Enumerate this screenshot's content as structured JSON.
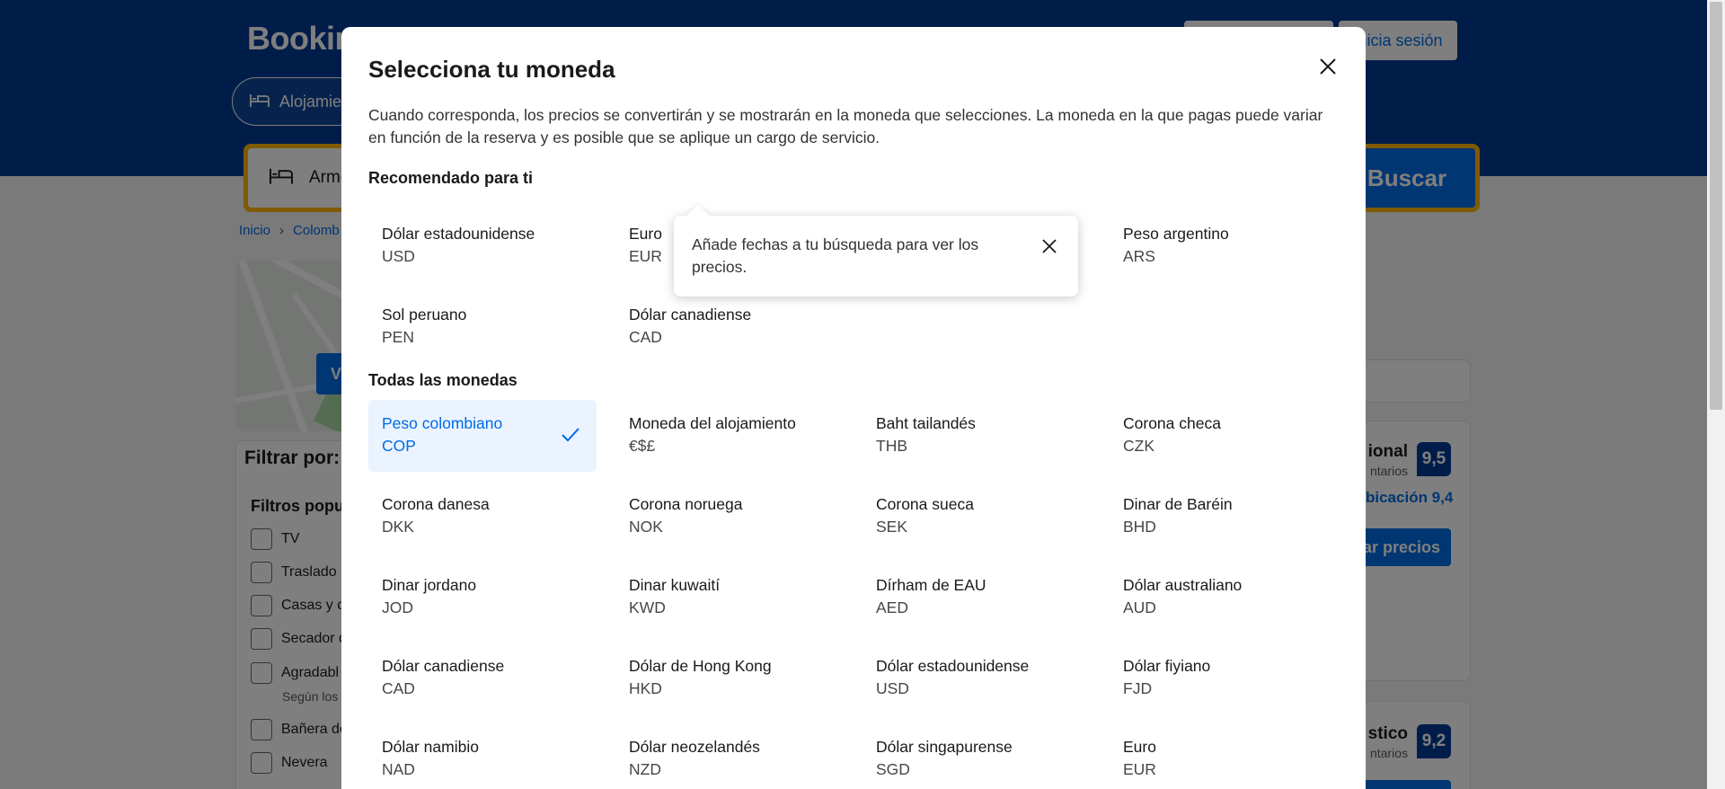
{
  "background": {
    "logo": "Booking",
    "header_buttons": [
      "",
      "Inicia sesión"
    ],
    "nav_pill": "Alojamie",
    "search_field": "Arme",
    "search_button": "Buscar",
    "breadcrumb": [
      "Inicio",
      "Colomb"
    ],
    "map_button": "V",
    "filters_title": "Filtrar por:",
    "filters_subtitle": "Filtros popul",
    "filter_items": [
      "TV",
      "Traslado",
      "Casas y c",
      "Secador d",
      "Agradabl",
      "Bañera de",
      "Nevera"
    ],
    "filter_note": "Según los",
    "cards": [
      {
        "name": "ional",
        "sub": "ntarios",
        "score": "9,5",
        "location": "bicación 9,4",
        "button": "ar precios"
      },
      {
        "name": "stico",
        "sub": "ntarios",
        "score": "9,2"
      }
    ]
  },
  "modal": {
    "title": "Selecciona tu moneda",
    "description": "Cuando corresponda, los precios se convertirán y se mostrarán en la moneda que selecciones. La moneda en la que pagas puede variar en función de la reserva y es posible que se aplique un cargo de servicio.",
    "recommended_heading": "Recomendado para ti",
    "recommended": [
      {
        "name": "Dólar estadounidense",
        "code": "USD"
      },
      {
        "name": "Euro",
        "code": "EUR"
      },
      {
        "name": "Peso argentino",
        "code": "ARS"
      },
      {
        "name": "Sol peruano",
        "code": "PEN"
      },
      {
        "name": "Dólar canadiense",
        "code": "CAD"
      }
    ],
    "all_heading": "Todas las monedas",
    "all": [
      {
        "name": "Peso colombiano",
        "code": "COP"
      },
      {
        "name": "Moneda del alojamiento",
        "code": "€$£"
      },
      {
        "name": "Baht tailandés",
        "code": "THB"
      },
      {
        "name": "Corona checa",
        "code": "CZK"
      },
      {
        "name": "Corona danesa",
        "code": "DKK"
      },
      {
        "name": "Corona noruega",
        "code": "NOK"
      },
      {
        "name": "Corona sueca",
        "code": "SEK"
      },
      {
        "name": "Dinar de Baréin",
        "code": "BHD"
      },
      {
        "name": "Dinar jordano",
        "code": "JOD"
      },
      {
        "name": "Dinar kuwaití",
        "code": "KWD"
      },
      {
        "name": "Dírham de EAU",
        "code": "AED"
      },
      {
        "name": "Dólar australiano",
        "code": "AUD"
      },
      {
        "name": "Dólar canadiense",
        "code": "CAD"
      },
      {
        "name": "Dólar de Hong Kong",
        "code": "HKD"
      },
      {
        "name": "Dólar estadounidense",
        "code": "USD"
      },
      {
        "name": "Dólar fiyiano",
        "code": "FJD"
      },
      {
        "name": "Dólar namibio",
        "code": "NAD"
      },
      {
        "name": "Dólar neozelandés",
        "code": "NZD"
      },
      {
        "name": "Dólar singapurense",
        "code": "SGD"
      },
      {
        "name": "Euro",
        "code": "EUR"
      }
    ],
    "selected_code": "COP"
  },
  "tooltip": {
    "text": "Añade fechas a tu búsqueda para ver los precios."
  },
  "colors": {
    "brand_blue": "#003b95",
    "accent_blue": "#006ce4",
    "selected_bg": "#ebf3ff",
    "yellow": "#ffb700"
  },
  "icons": [
    "bed-icon",
    "close-icon",
    "check-icon",
    "chevron-right-icon"
  ]
}
